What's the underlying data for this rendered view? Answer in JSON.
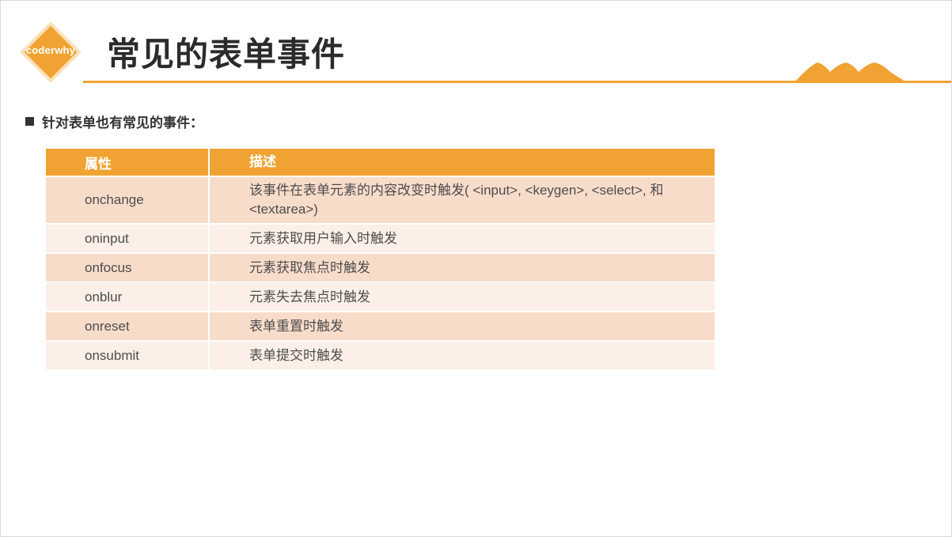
{
  "logo": {
    "text": "coderwhy",
    "color": "#f0a332"
  },
  "title": "常见的表单事件",
  "bullet": "针对表单也有常见的事件：",
  "table": {
    "headers": [
      "属性",
      "描述"
    ],
    "rows": [
      {
        "attr": "onchange",
        "desc": "该事件在表单元素的内容改变时触发( <input>, <keygen>, <select>, 和 <textarea>)"
      },
      {
        "attr": "oninput",
        "desc": "元素获取用户输入时触发"
      },
      {
        "attr": "onfocus",
        "desc": "元素获取焦点时触发"
      },
      {
        "attr": "onblur",
        "desc": "元素失去焦点时触发"
      },
      {
        "attr": "onreset",
        "desc": "表单重置时触发"
      },
      {
        "attr": "onsubmit",
        "desc": "表单提交时触发"
      }
    ]
  },
  "colors": {
    "accent": "#f0a332",
    "row_dark": "#f8dcca",
    "row_light": "#fcefe7",
    "text": "#4d4d4d"
  }
}
